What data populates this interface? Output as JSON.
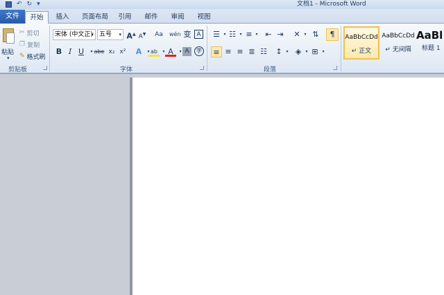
{
  "window": {
    "title": "文档1 - Microsoft Word"
  },
  "quick_access": {
    "undo_glyph": "↶",
    "redo_glyph": "↻",
    "dropdown_glyph": "▾"
  },
  "tabs": [
    {
      "label": "文件"
    },
    {
      "label": "开始"
    },
    {
      "label": "插入"
    },
    {
      "label": "页面布局"
    },
    {
      "label": "引用"
    },
    {
      "label": "邮件"
    },
    {
      "label": "审阅"
    },
    {
      "label": "视图"
    }
  ],
  "clipboard": {
    "paste": "粘贴",
    "cut": "剪切",
    "copy": "复制",
    "format_painter": "格式刷",
    "group": "剪贴板"
  },
  "font": {
    "name": "宋体 (中文正)",
    "size": "五号",
    "grow": "A",
    "shrink": "A",
    "change_case": "Aa",
    "phonetic": "wén",
    "clear_format": "变",
    "border": "A",
    "bold": "B",
    "italic": "I",
    "underline": "U",
    "strike": "abe",
    "subscript": "x₂",
    "superscript": "x²",
    "effects": "A",
    "highlight": "ab",
    "font_color": "A",
    "char_shading": "A",
    "enclose": "字",
    "group": "字体"
  },
  "paragraph": {
    "group": "段落"
  },
  "styles": [
    {
      "sample": "AaBbCcDd",
      "name": "↵ 正文"
    },
    {
      "sample": "AaBbCcDd",
      "name": "↵ 无间隔"
    },
    {
      "sample": "AaBl",
      "name": "标题 1"
    }
  ],
  "colors": {
    "accent": "#2a5aa8",
    "selected_style": "#f0c04e",
    "font_color_bar": "#e02020",
    "highlight_bar": "#f7e43a"
  }
}
